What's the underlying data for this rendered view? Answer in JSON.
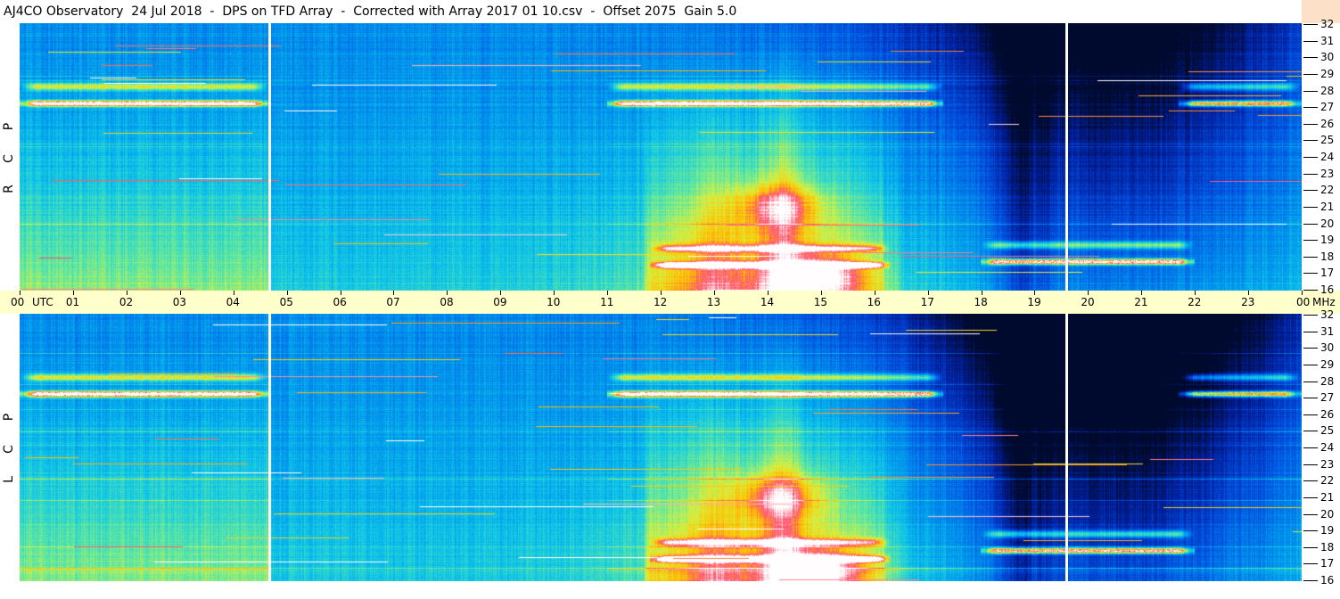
{
  "header": {
    "title": "AJ4CO Observatory  24 Jul 2018  -  DPS on TFD Array  -  Corrected with Array 2017 01 10.csv  -  Offset 2075  Gain 5.0"
  },
  "panels": {
    "rcp": {
      "letters": [
        "R",
        "C",
        "P"
      ]
    },
    "lcp": {
      "letters": [
        "L",
        "C",
        "P"
      ]
    }
  },
  "time_axis": {
    "unit_label": "UTC",
    "freq_unit_label": "MHz",
    "labels": [
      "00",
      "01",
      "02",
      "03",
      "04",
      "05",
      "06",
      "07",
      "08",
      "09",
      "10",
      "11",
      "12",
      "13",
      "14",
      "15",
      "16",
      "17",
      "18",
      "19",
      "20",
      "21",
      "22",
      "23",
      "00"
    ]
  },
  "chart_data": {
    "type": "heatmap",
    "title": "AJ4CO Observatory  24 Jul 2018  -  DPS on TFD Array  -  Corrected with Array 2017 01 10.csv  -  Offset 2075  Gain 5.0",
    "x_unit": "UTC",
    "y_unit": "MHz",
    "xlim": [
      0,
      24
    ],
    "ylim": [
      16,
      32
    ],
    "x_ticks": [
      "00",
      "01",
      "02",
      "03",
      "04",
      "05",
      "06",
      "07",
      "08",
      "09",
      "10",
      "11",
      "12",
      "13",
      "14",
      "15",
      "16",
      "17",
      "18",
      "19",
      "20",
      "21",
      "22",
      "23",
      "00"
    ],
    "y_ticks": [
      16,
      17,
      18,
      19,
      20,
      21,
      22,
      23,
      24,
      25,
      26,
      27,
      28,
      29,
      30,
      31,
      32
    ],
    "grid": false,
    "colormap": [
      "#000a2e",
      "#0020a0",
      "#0050e0",
      "#0090ee",
      "#10c8e8",
      "#60e8a0",
      "#d8f040",
      "#ffc000",
      "#ff5070",
      "#ffffff"
    ],
    "data_gaps_utc": [
      4.68,
      19.6
    ],
    "panels": [
      {
        "polarization": "RCP",
        "strong_bands_mhz": [
          {
            "freq": 27.2,
            "start": 0.0,
            "end": 4.65,
            "intensity": 0.9
          },
          {
            "freq": 27.2,
            "start": 11.0,
            "end": 17.3,
            "intensity": 0.92
          },
          {
            "freq": 27.2,
            "start": 21.7,
            "end": 24.0,
            "intensity": 0.8
          },
          {
            "freq": 17.5,
            "start": 11.8,
            "end": 16.3,
            "intensity": 0.78
          },
          {
            "freq": 17.7,
            "start": 18.0,
            "end": 22.0,
            "intensity": 0.9
          }
        ],
        "hotspots": [
          {
            "utc": 15.0,
            "freq": 16.8,
            "intensity": 0.8
          },
          {
            "utc": 14.2,
            "freq": 21.0,
            "intensity": 0.65
          }
        ]
      },
      {
        "polarization": "LCP",
        "strong_bands_mhz": [
          {
            "freq": 27.2,
            "start": 0.0,
            "end": 4.65,
            "intensity": 0.9
          },
          {
            "freq": 27.2,
            "start": 11.0,
            "end": 17.3,
            "intensity": 0.92
          },
          {
            "freq": 27.2,
            "start": 21.7,
            "end": 24.0,
            "intensity": 0.78
          },
          {
            "freq": 17.3,
            "start": 11.8,
            "end": 16.3,
            "intensity": 0.8
          },
          {
            "freq": 17.8,
            "start": 18.0,
            "end": 22.0,
            "intensity": 0.9
          }
        ],
        "hotspots": [
          {
            "utc": 15.0,
            "freq": 16.6,
            "intensity": 0.82
          },
          {
            "utc": 14.2,
            "freq": 21.0,
            "intensity": 0.65
          }
        ]
      }
    ]
  }
}
